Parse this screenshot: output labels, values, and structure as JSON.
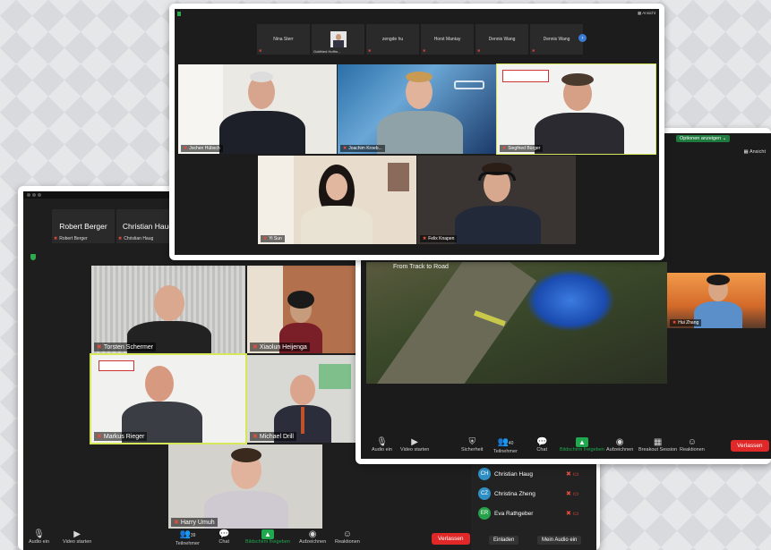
{
  "win_left": {
    "strip": [
      {
        "name": "Robert Berger",
        "label": "Robert Berger"
      },
      {
        "name": "Christian Haug",
        "label": "Christian Haug"
      }
    ],
    "tiles": [
      "Torsten Schermer",
      "Xiaolun Heijenga",
      "Markus Rieger",
      "Michael Drill",
      "Harry Umuh"
    ],
    "toolbar": {
      "audio": "Audio ein",
      "video": "Video starten",
      "participants": "Teilnehmer",
      "participants_count": "39",
      "chat": "Chat",
      "share": "Bildschirm freigeben",
      "record": "Aufzeichnen",
      "reactions": "Reaktionen",
      "leave": "Verlassen"
    },
    "participants_panel": {
      "items": [
        {
          "initials": "CH",
          "name": "Christian Haug",
          "color": "#2f8fc4"
        },
        {
          "initials": "CZ",
          "name": "Christina Zheng",
          "color": "#2f8fc4"
        },
        {
          "initials": "ER",
          "name": "Eva Rathgeber",
          "color": "#27a04a"
        }
      ],
      "invite": "Einladen",
      "mute": "Mein Audio ein"
    }
  },
  "win_right": {
    "options": "Optionen anzeigen ⌄",
    "view": "Ansicht",
    "share_title": "From Track to Road",
    "side_person": "Hui Zhang",
    "toolbar": {
      "audio": "Audio ein",
      "video": "Video starten",
      "security": "Sicherheit",
      "participants": "Teilnehmer",
      "participants_count": "40",
      "chat": "Chat",
      "share": "Bildschirm freigeben",
      "record": "Aufzeichnen",
      "breakout": "Breakout Session",
      "reactions": "Reaktionen",
      "leave": "Verlassen"
    }
  },
  "win_top": {
    "view": "Ansicht",
    "strip": [
      "Nina Sterr",
      "",
      "zengde hu",
      "Horst Mantay",
      "Dennis Wang",
      "Dennis Wang"
    ],
    "strip_caption": "Gottfried Hoffm...",
    "tiles": [
      "Jochen Hübsch",
      "Joachim Kroeb...",
      "Siegfried Bürger",
      "Yi Sun",
      "Felix Knapen"
    ]
  },
  "colors": {
    "zoom_dark": "#1a1a1a",
    "share_green": "#1fa84e",
    "leave_red": "#e02828",
    "highlight": "#d6e85a"
  }
}
